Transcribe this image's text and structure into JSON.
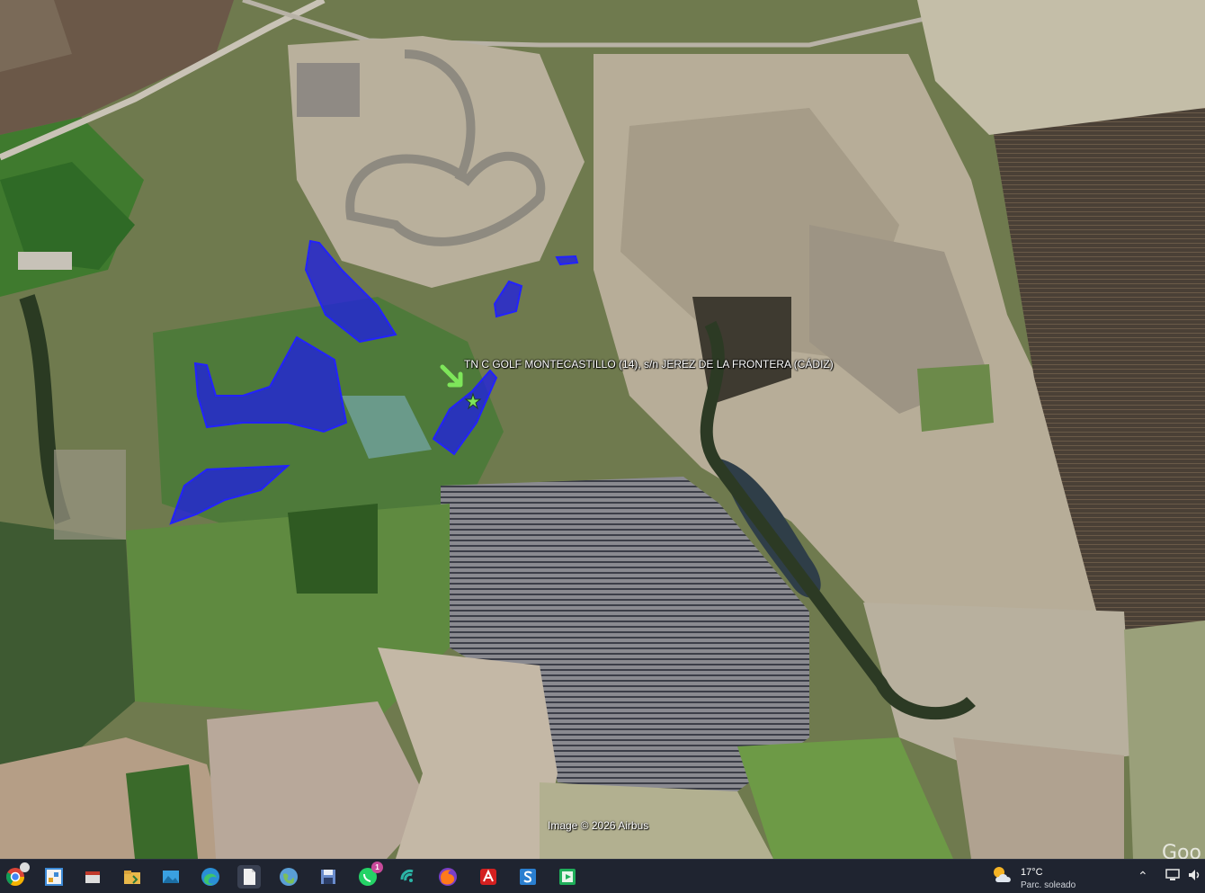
{
  "map": {
    "placemark_label": "TN C GOLF MONTECASTILLO (14), s/n JEREZ DE LA FRONTERA (CÁDIZ)",
    "image_credit": "Image © 2026 Airbus",
    "logo_partial": "Goo",
    "polygon_fill_color": "#1e1ee6",
    "polygon_stroke_color": "#2222ff",
    "marker_color": "#7ee65a"
  },
  "taskbar": {
    "apps": [
      {
        "name": "chrome-icon",
        "badge": "",
        "color": "#e0b020"
      },
      {
        "name": "paint-icon",
        "badge": "",
        "color": "#3d8ad6"
      },
      {
        "name": "snipping-tool-icon",
        "badge": "",
        "color": "#c0392b"
      },
      {
        "name": "file-explorer-icon",
        "badge": "",
        "color": "#e8b84a"
      },
      {
        "name": "photos-icon",
        "badge": "",
        "color": "#3aa0e0"
      },
      {
        "name": "edge-icon",
        "badge": "",
        "color": "#2a8fd6"
      },
      {
        "name": "notepad-icon",
        "badge": "",
        "color": "#f0f0f0"
      },
      {
        "name": "google-earth-icon",
        "badge": "",
        "color": "#5a9fd6"
      },
      {
        "name": "save-disk-icon",
        "badge": "",
        "color": "#6a8ccc"
      },
      {
        "name": "whatsapp-icon",
        "badge": "1",
        "color": "#25d366"
      },
      {
        "name": "wifi-app-icon",
        "badge": "",
        "color": "#2bb5a6"
      },
      {
        "name": "firefox-icon",
        "badge": "",
        "color": "#ff7a1a"
      },
      {
        "name": "acrobat-icon",
        "badge": "",
        "color": "#d42020"
      },
      {
        "name": "sql-app-icon",
        "badge": "",
        "color": "#2a7fd0"
      },
      {
        "name": "media-player-icon",
        "badge": "",
        "color": "#1fae5a"
      }
    ],
    "weather": {
      "temperature": "17°C",
      "description": "Parc. soleado"
    }
  }
}
